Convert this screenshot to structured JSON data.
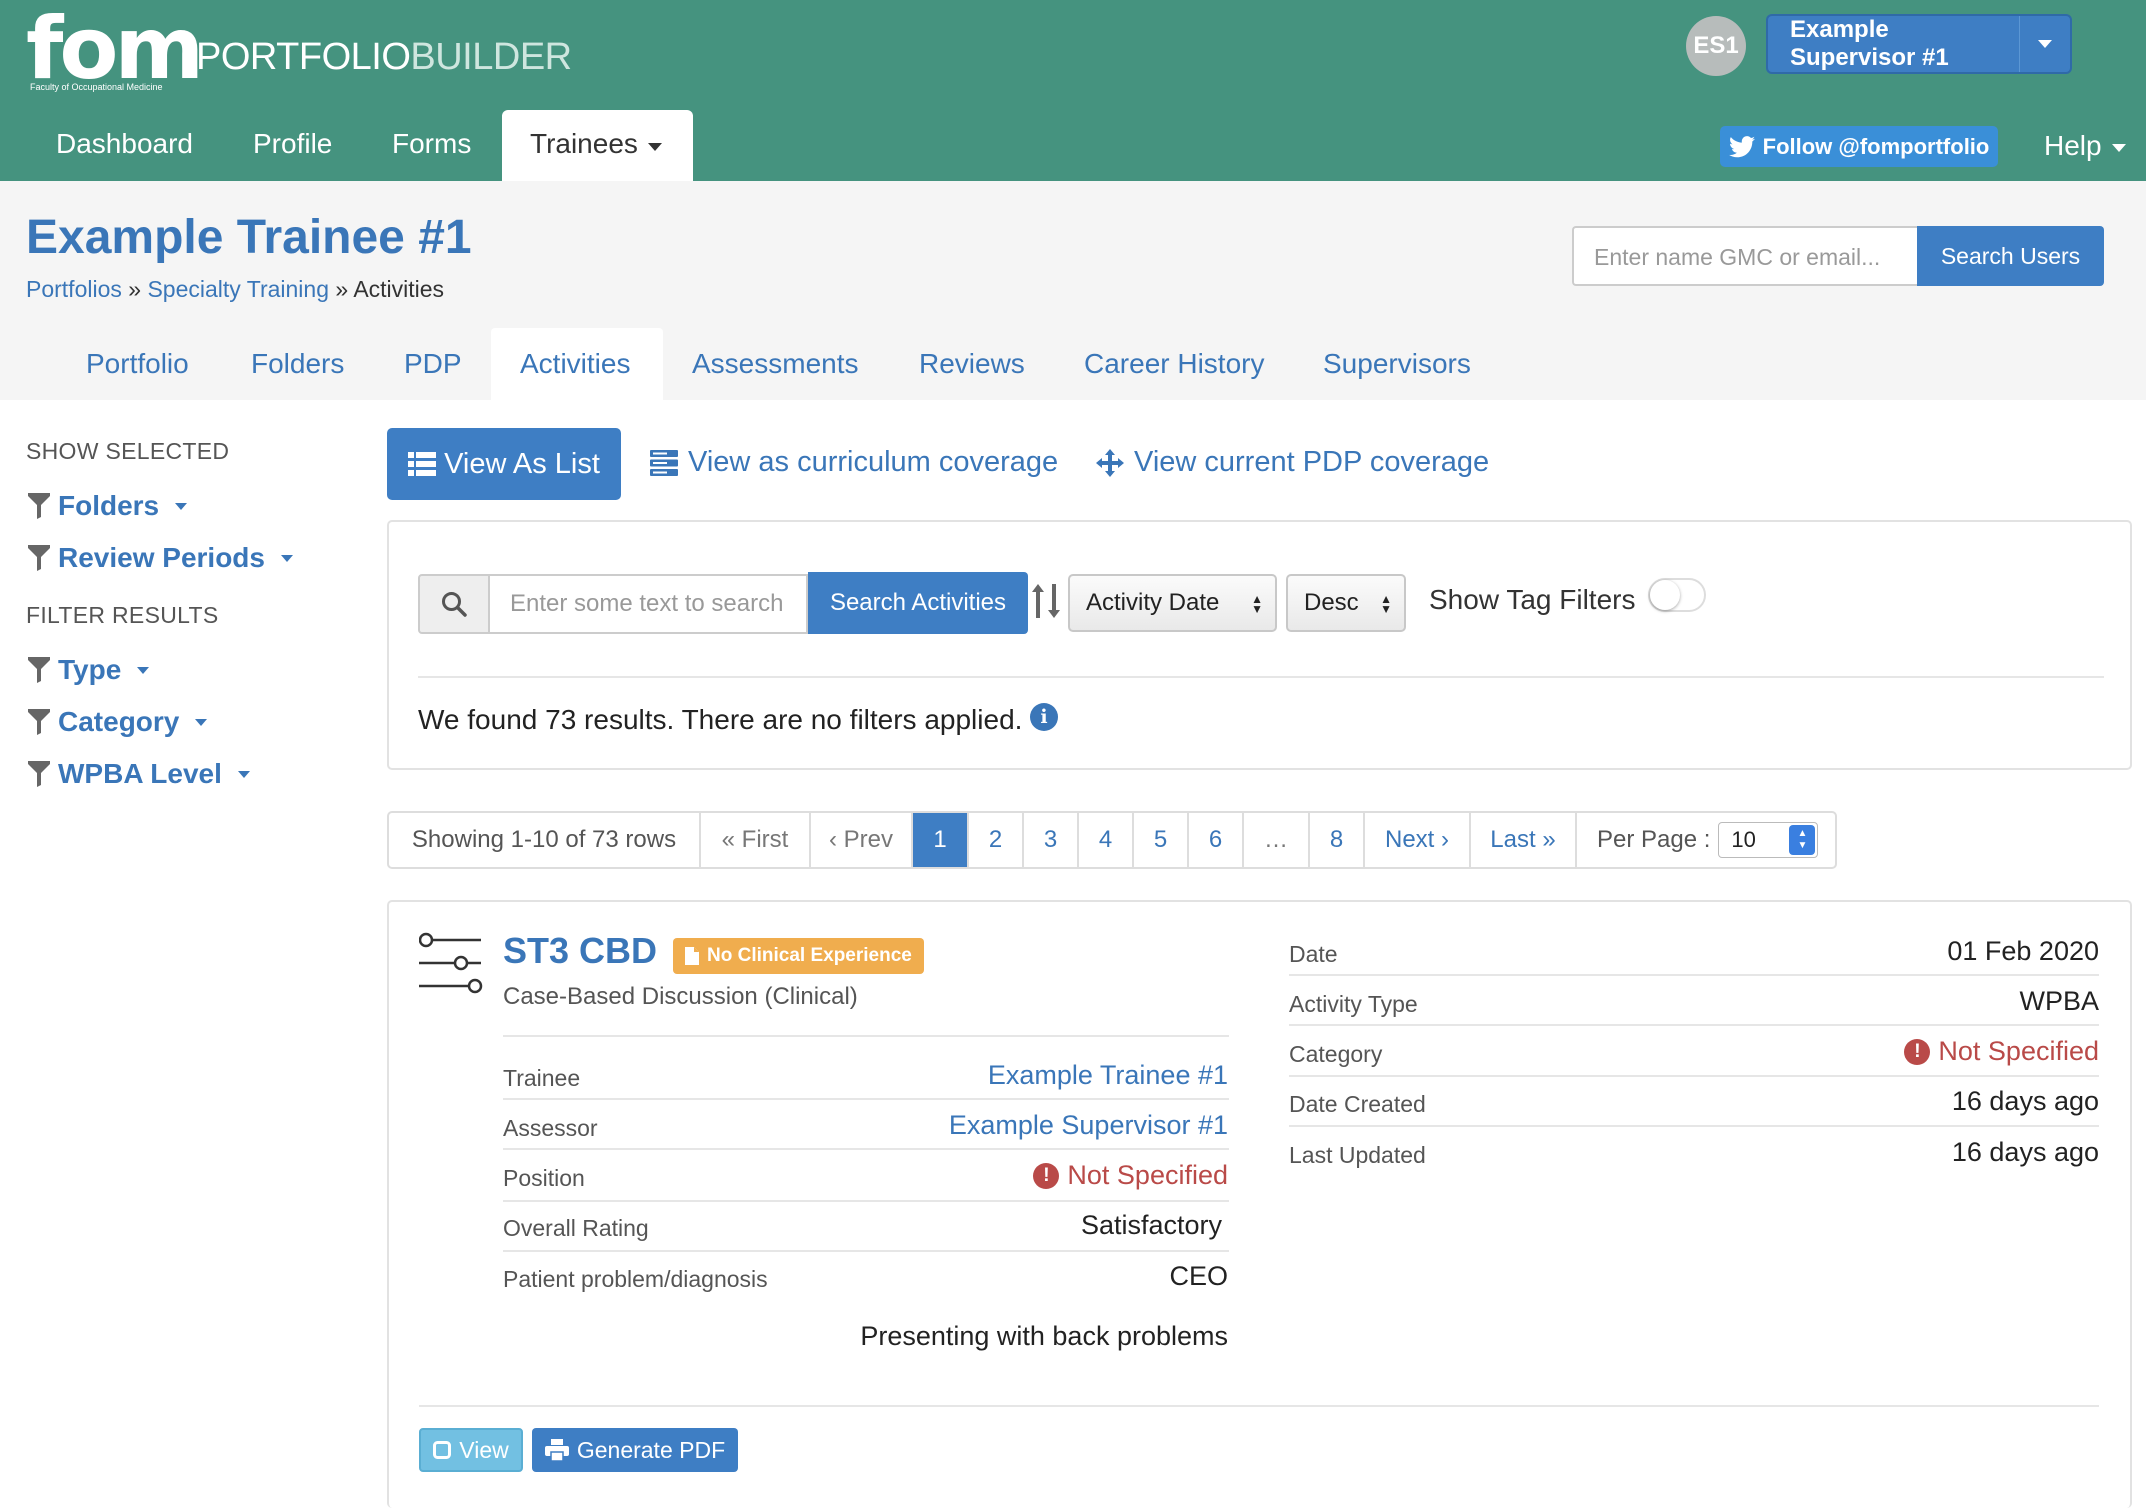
{
  "brand": {
    "logo": "fom",
    "logo_sub": "Faculty of Occupational Medicine",
    "name_a": "PORTFOLIO",
    "name_b": "BUILDER"
  },
  "user": {
    "initials": "ES1",
    "name": "Example Supervisor #1"
  },
  "nav": {
    "items": [
      "Dashboard",
      "Profile",
      "Forms",
      "Trainees"
    ],
    "follow": "Follow @fomportfolio",
    "help": "Help"
  },
  "page": {
    "title": "Example Trainee #1",
    "breadcrumbs": [
      "Portfolios",
      "Specialty Training",
      "Activities"
    ],
    "breadcrumb_sep": "»"
  },
  "user_search": {
    "placeholder": "Enter name GMC or email...",
    "button": "Search Users"
  },
  "tabs": [
    "Portfolio",
    "Folders",
    "PDP",
    "Activities",
    "Assessments",
    "Reviews",
    "Career History",
    "Supervisors"
  ],
  "sidebar": {
    "show_selected": "SHOW SELECTED",
    "show_filters": [
      "Folders",
      "Review Periods"
    ],
    "filter_results": "FILTER RESULTS",
    "result_filters": [
      "Type",
      "Category",
      "WPBA Level"
    ]
  },
  "views": {
    "list": "View As List",
    "curriculum": "View as curriculum coverage",
    "pdp": "View current PDP coverage"
  },
  "search": {
    "placeholder": "Enter some text to search",
    "button": "Search Activities",
    "sort_field": "Activity Date",
    "sort_order": "Desc",
    "tag_filters_label": "Show Tag Filters",
    "tag_filters_on": false,
    "results_text": "We found 73 results. There are no filters applied."
  },
  "pagination": {
    "showing": "Showing 1-10 of 73 rows",
    "first": "« First",
    "prev": "‹ Prev",
    "pages": [
      "1",
      "2",
      "3",
      "4",
      "5",
      "6",
      "…",
      "8"
    ],
    "current": "1",
    "next": "Next ›",
    "last": "Last »",
    "per_page_label": "Per Page :",
    "per_page": "10"
  },
  "activity": {
    "title": "ST3 CBD",
    "badge": "No Clinical Experience",
    "subtitle": "Case-Based Discussion (Clinical)",
    "details": [
      {
        "label": "Trainee",
        "value": "Example Trainee #1"
      },
      {
        "label": "Assessor",
        "value": "Example Supervisor #1"
      },
      {
        "label": "Position",
        "value": "Not Specified"
      },
      {
        "label": "Overall Rating",
        "value": "Satisfactory"
      },
      {
        "label": "Patient problem/diagnosis",
        "value": "CEO"
      }
    ],
    "extra": "Presenting with back problems",
    "meta": [
      {
        "label": "Date",
        "value": "01 Feb 2020"
      },
      {
        "label": "Activity Type",
        "value": "WPBA"
      },
      {
        "label": "Category",
        "value": "Not Specified"
      },
      {
        "label": "Date Created",
        "value": "16 days ago"
      },
      {
        "label": "Last Updated",
        "value": "16 days ago"
      }
    ],
    "view_button": "View",
    "pdf_button": "Generate PDF"
  },
  "colors": {
    "header": "#45937f",
    "primary": "#3e7ec4",
    "link": "#3a76b8",
    "warning": "#b94a48",
    "badge": "#f0ad4e"
  }
}
